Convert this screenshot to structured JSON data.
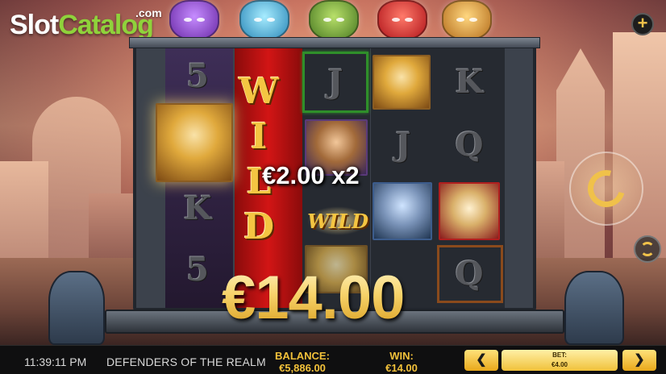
{
  "branding": {
    "logo_slot": "Slot",
    "logo_catalog": "Catalog",
    "logo_com": ".com"
  },
  "reels": {
    "wild_letters": [
      "W",
      "I",
      "L",
      "D"
    ],
    "wild_small": "WILD",
    "symbols": {
      "r1_top": "5",
      "r1_mid": "K",
      "r1_bot": "5",
      "r3_top": "J",
      "r4_mid": "J",
      "r5_top": "K",
      "r5_mid": "Q",
      "r5_bot": "Q"
    }
  },
  "win": {
    "line_win": "€2.00 x2",
    "total_win": "€14.00"
  },
  "status_bar": {
    "clock": "11:39:11 PM",
    "game_title": "DEFENDERS OF THE REALM",
    "balance_label": "BALANCE:",
    "balance_value": "€5,886.00",
    "win_label": "WIN:",
    "win_value": "€14.00",
    "bet_label": "BET:",
    "bet_value": "€4.00",
    "bet_decrease": "❮",
    "bet_increase": "❯"
  },
  "controls": {
    "plus": "+"
  }
}
